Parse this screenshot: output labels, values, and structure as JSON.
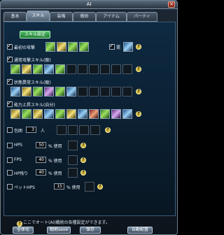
{
  "window": {
    "title": "AI",
    "close_label": "×"
  },
  "tabs": [
    "基本",
    "スキル",
    "装備",
    "戦術",
    "アイテム",
    "パーティ"
  ],
  "panel": {
    "title": "スキル設定"
  },
  "sections": {
    "normal_attack": {
      "label": "最初の攻撃",
      "extra_label": "罠"
    },
    "common_skill": {
      "label": "通常攻撃スキル(敵)"
    },
    "status_skill": {
      "label": "状態異常スキル(敵)"
    },
    "buff_skill": {
      "label": "能力上昇スキル(自分)"
    }
  },
  "conditions": {
    "surround": {
      "label": "包囲",
      "value": "3",
      "unit": "人"
    },
    "hp": {
      "label": "HPS",
      "value": "50",
      "suffix": "% 使用"
    },
    "fp": {
      "label": "FPS",
      "value": "40",
      "suffix": "% 使用"
    },
    "hp_remain": {
      "label": "HP残り",
      "value": "40",
      "suffix": "% 使用"
    },
    "pet_hp": {
      "label": "ペットHPS",
      "value": "15",
      "suffix": "% 使用"
    }
  },
  "help": {
    "icon_text": "?",
    "message": "ここでオート(AI)戦術の各種設定ができます。"
  },
  "buttons": {
    "all": "全体化",
    "memo": "戦術save",
    "save": "保存",
    "auto": "自動配置"
  },
  "colors": {
    "accent": "#53c06a",
    "panel": "#0e2a42",
    "help_icon": "#f4e26a"
  }
}
